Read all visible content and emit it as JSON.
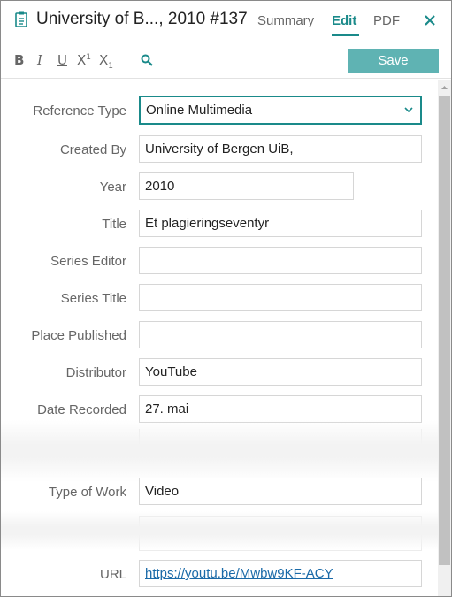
{
  "header": {
    "title": "University of B..., 2010 #137",
    "tabs": [
      {
        "label": "Summary"
      },
      {
        "label": "Edit"
      },
      {
        "label": "PDF"
      }
    ]
  },
  "toolbar": {
    "bold": "B",
    "italic": "I",
    "underline": "U",
    "superscript_base": "X",
    "superscript_mark": "1",
    "subscript_base": "X",
    "subscript_mark": "1",
    "save_label": "Save"
  },
  "form": {
    "reference_type": {
      "label": "Reference Type",
      "value": "Online Multimedia"
    },
    "created_by": {
      "label": "Created By",
      "value": "University of Bergen UiB,"
    },
    "year": {
      "label": "Year",
      "value": "2010"
    },
    "title": {
      "label": "Title",
      "value": "Et plagieringseventyr"
    },
    "series_editor": {
      "label": "Series Editor",
      "value": ""
    },
    "series_title": {
      "label": "Series Title",
      "value": ""
    },
    "place_published": {
      "label": "Place Published",
      "value": ""
    },
    "distributor": {
      "label": "Distributor",
      "value": "YouTube"
    },
    "date_recorded": {
      "label": "Date Recorded",
      "value": "27. mai"
    },
    "type_of_work": {
      "label": "Type of Work",
      "value": "Video"
    },
    "url": {
      "label": "URL",
      "value": "https://youtu.be/Mwbw9KF-ACY"
    }
  },
  "colors": {
    "accent": "#1a8a8a",
    "save_button": "#5fb3b3",
    "link": "#1a6aa8"
  },
  "icons": [
    "clipboard-icon",
    "close-icon",
    "search-icon",
    "chevron-down-icon"
  ]
}
